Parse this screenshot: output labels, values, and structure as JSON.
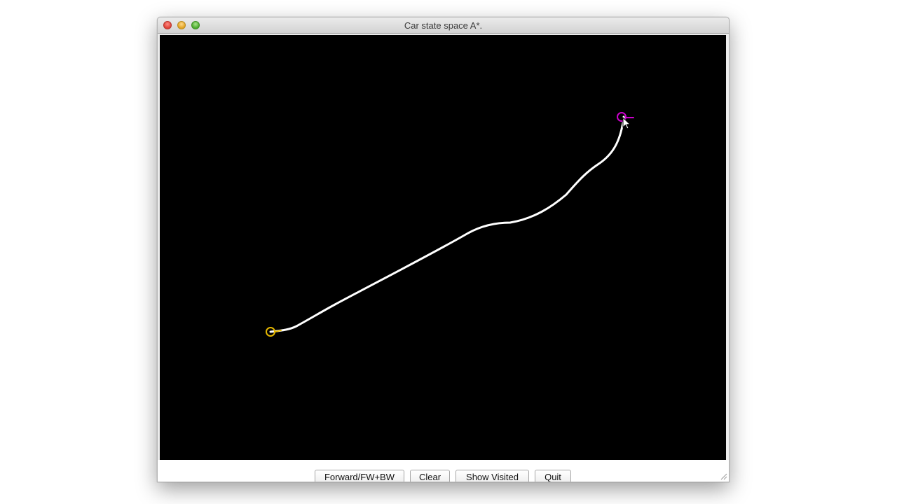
{
  "window": {
    "title": "Car state space A*."
  },
  "buttons": {
    "forward": "Forward/FW+BW",
    "clear": "Clear",
    "show_visited": "Show Visited",
    "quit": "Quit"
  },
  "colors": {
    "canvas_background": "#000000",
    "path": "#ffffff",
    "start_marker": "#e6b800",
    "goal_marker": "#cc00cc"
  },
  "icons": {
    "start": "start-circle-icon",
    "goal": "goal-circle-icon",
    "cursor": "mouse-pointer-icon"
  }
}
